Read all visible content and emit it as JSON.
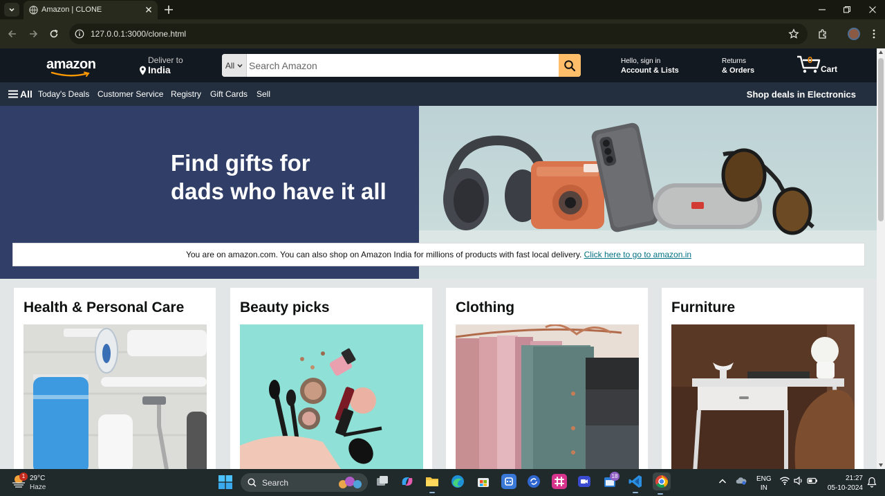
{
  "browser": {
    "tab_title": "Amazon | CLONE",
    "url": "127.0.0.1:3000/clone.html",
    "icons": [
      "tab-list-icon",
      "globe-icon",
      "close-icon",
      "plus-icon",
      "minimize-icon",
      "restore-icon",
      "back-icon",
      "forward-icon",
      "reload-icon",
      "info-icon",
      "star-icon",
      "extensions-icon",
      "more-icon"
    ]
  },
  "header": {
    "logo": "amazon",
    "deliver_label": "Deliver to",
    "deliver_location": "India",
    "search": {
      "category": "All",
      "placeholder": "Search Amazon"
    },
    "account_line1": "Hello, sign in",
    "account_line2": "Account & Lists",
    "returns_line1": "Returns",
    "returns_line2": "& Orders",
    "cart_count": "0",
    "cart_label": "Cart"
  },
  "subnav": {
    "all_label": "All",
    "items": [
      "Today's Deals",
      "Customer Service",
      "Registry",
      "Gift Cards",
      "Sell"
    ],
    "promo": "Shop deals in Electronics"
  },
  "hero": {
    "headline_line1": "Find gifts for",
    "headline_line2": "dads who have it all",
    "background_color": "#303e68"
  },
  "notice": {
    "text": "You are on amazon.com. You can also shop on Amazon India for millions of products with fast local delivery. ",
    "link_text": "Click here to go to amazon.in"
  },
  "cards": [
    {
      "title": "Health & Personal Care"
    },
    {
      "title": "Beauty picks"
    },
    {
      "title": "Clothing"
    },
    {
      "title": "Furniture"
    }
  ],
  "taskbar": {
    "weather_temp": "29°C",
    "weather_condition": "Haze",
    "weather_badge": "1",
    "search_label": "Search",
    "notification_count": "18",
    "language_line1": "ENG",
    "language_line2": "IN",
    "time": "21:27",
    "date": "05-10-2024"
  },
  "colors": {
    "header_bg": "#131921",
    "subnav_bg": "#232f3e",
    "search_button": "#febd69",
    "cart_count": "#f08804",
    "link": "#007185"
  }
}
